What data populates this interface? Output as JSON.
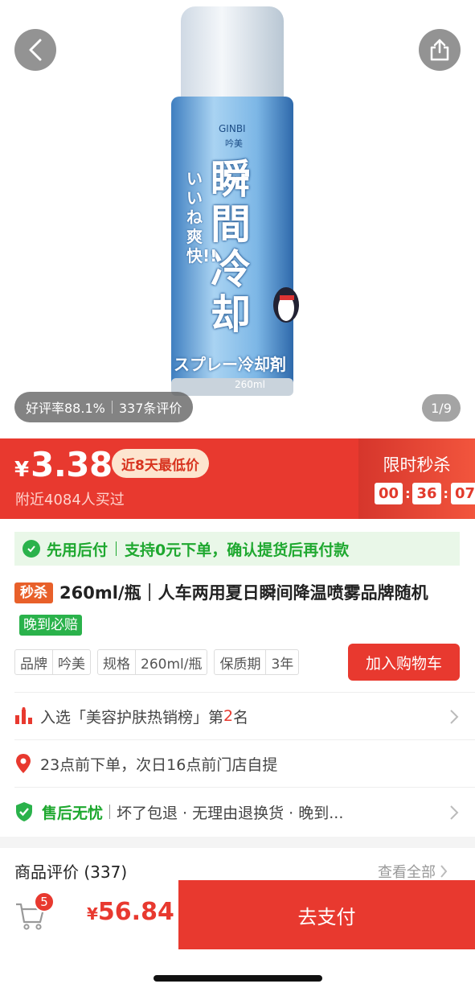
{
  "hero": {
    "can_brand_en": "GINBI",
    "can_brand_cn": "吟美",
    "can_main_text": "瞬間冷却",
    "can_side_text": "いいね爽快!!",
    "can_bottom_text": "スプレー冷却剤",
    "can_volume": "260ml",
    "rating_label": "好评率88.1%",
    "review_count_label": "337条评价",
    "pager": "1/9"
  },
  "price": {
    "currency": "¥",
    "value": "3.38",
    "lowest_tag": "近8天最低价",
    "bought_text": "附近4084人买过",
    "flash_title": "限时秒杀",
    "countdown": [
      "00",
      "36",
      "07"
    ]
  },
  "paylater": {
    "label": "先用后付",
    "detail": "支持0元下单，确认提货后再付款"
  },
  "product": {
    "seckill_tag": "秒杀",
    "title": "260ml/瓶｜人车两用夏日瞬间降温喷雾品牌随机",
    "late_tag": "晚到必赔"
  },
  "specs": [
    {
      "key": "品牌",
      "value": "吟美"
    },
    {
      "key": "规格",
      "value": "260ml/瓶"
    },
    {
      "key": "保质期",
      "value": "3年"
    }
  ],
  "cart_button": "加入购物车",
  "rows": {
    "rank_prefix": "入选「美容护肤热销榜」第",
    "rank_num": "2",
    "rank_suffix": "名",
    "pickup": "23点前下单，次日16点前门店自提",
    "after_sale_label": "售后无忧",
    "after_sale_detail": "坏了包退 · 无理由退换货 · 晚到..."
  },
  "reviews": {
    "title": "商品评价 (337)",
    "see_all": "查看全部"
  },
  "bottom": {
    "cart_badge": "5",
    "currency": "¥",
    "total": "56.84",
    "pay_label": "去支付"
  },
  "colors": {
    "accent": "#e8392f",
    "green": "#1ea82f"
  }
}
